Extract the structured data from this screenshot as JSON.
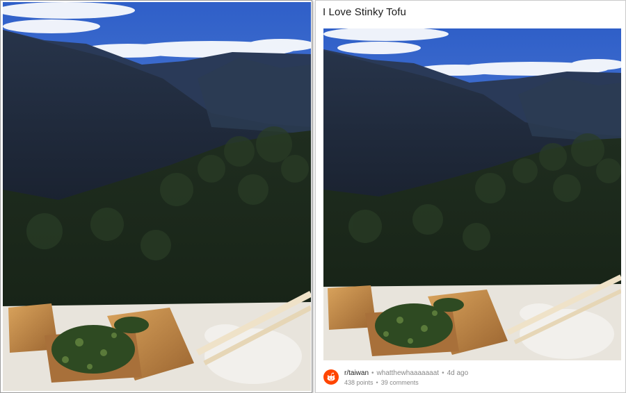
{
  "post": {
    "title": "I Love Stinky Tofu",
    "subreddit": "r/taiwan",
    "author": "whatthewhaaaaaaat",
    "age": "4d ago",
    "points": "438 points",
    "comments": "39 comments",
    "separator": "•"
  },
  "icons": {
    "subreddit": "reddit-alien-icon"
  },
  "colors": {
    "reddit_orange": "#ff4500",
    "sky": "#3f6fd0",
    "mountain": "#1f2a38",
    "forest": "#1e2f1c",
    "tofu": "#c98f4a"
  }
}
